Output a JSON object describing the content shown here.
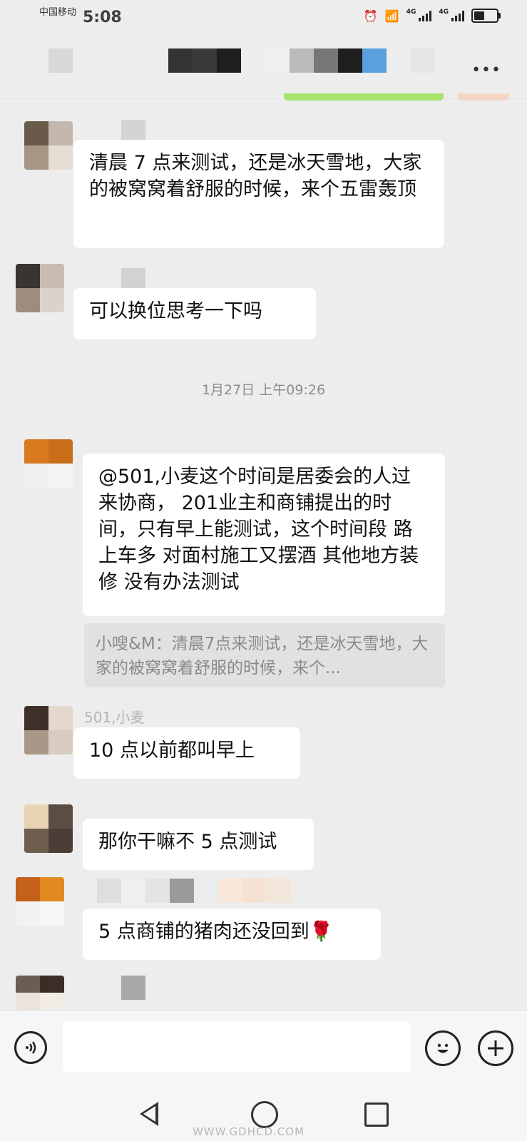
{
  "status_bar": {
    "carrier": "中国移动",
    "time": "5:08",
    "network_1": "4G",
    "network_2": "4G"
  },
  "header": {
    "more_label": "•••"
  },
  "messages": [
    {
      "text": "清晨 7 点来测试，还是冰天雪地，大家的被窝窝着舒服的时候，来个五雷轰顶"
    },
    {
      "text": "可以换位思考一下吗"
    },
    {
      "text": "@501,小麦这个时间是居委会的人过来协商， 201业主和商铺提出的时间，只有早上能测试，这个时间段 路上车多 对面村施工又摆酒 其他地方装修  没有办法测试"
    },
    {
      "text": "10 点以前都叫早上",
      "sender": "501,小麦"
    },
    {
      "text": "那你干嘛不 5 点测试"
    },
    {
      "text": "5 点商铺的猪肉还没回到🌹"
    }
  ],
  "timestamp": "1月27日 上午09:26",
  "quote": {
    "text": "小嗖&M：清晨7点来测试，还是冰天雪地，大家的被窝窝着舒服的时候，来个..."
  },
  "input": {
    "value": "",
    "placeholder": ""
  },
  "icons": {
    "voice": "voice-icon",
    "emoji": "emoji-icon",
    "plus": "plus-icon",
    "back": "back-icon",
    "home": "home-icon",
    "recent": "recent-apps-icon"
  },
  "watermark": "WWW.GDHCD.COM"
}
